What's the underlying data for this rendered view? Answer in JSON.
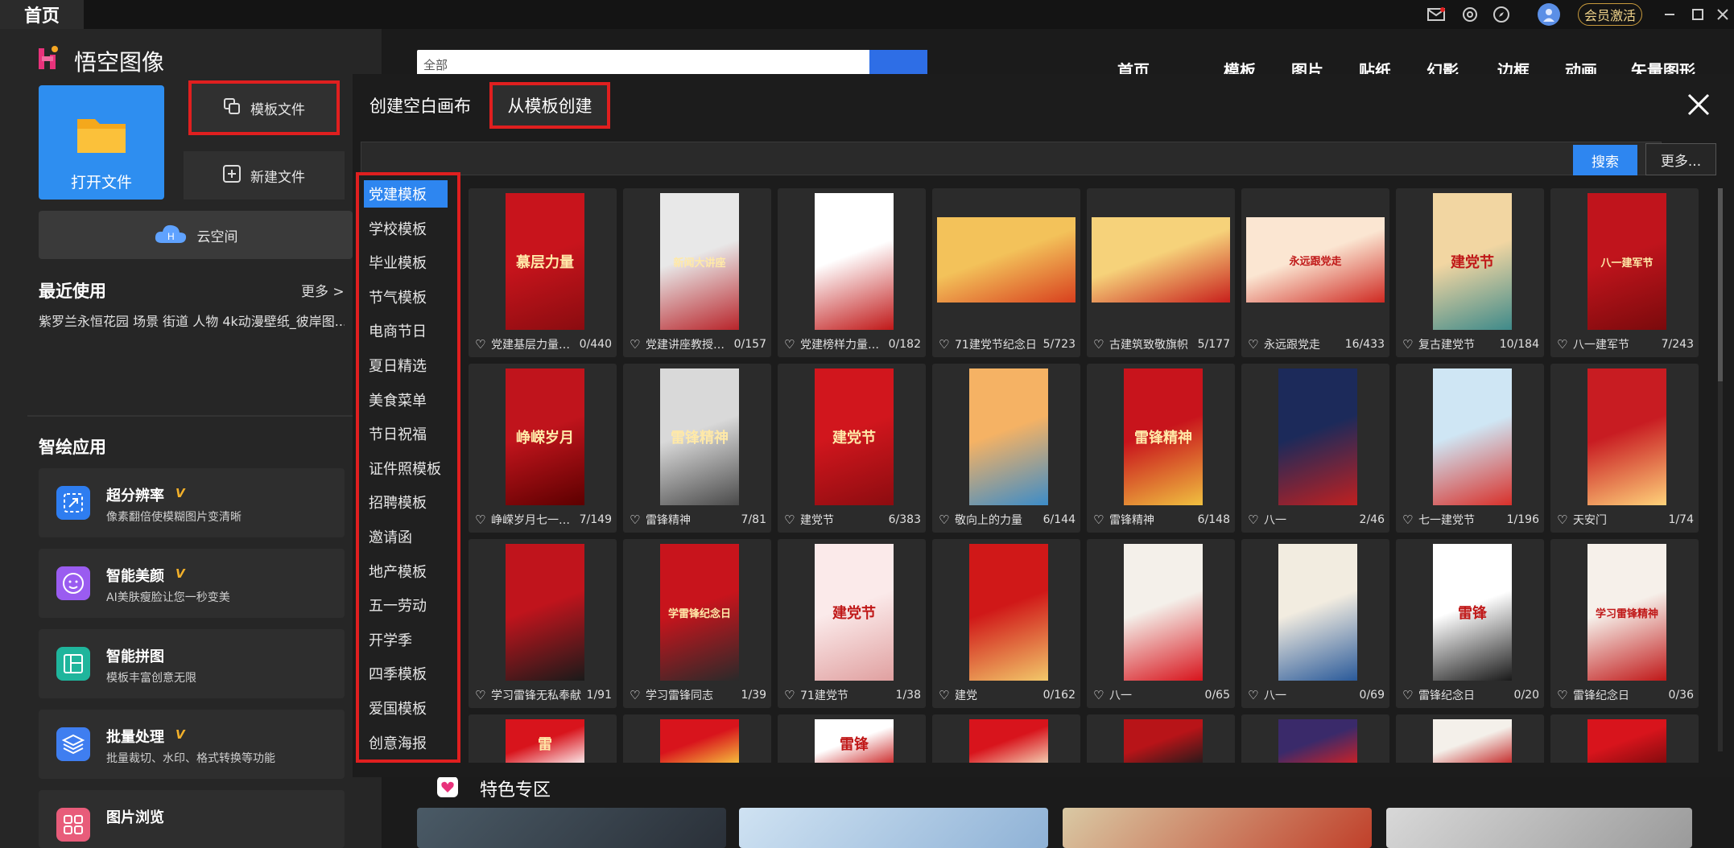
{
  "topbar": {
    "home_tab": "首页",
    "vip_button": "会员激活"
  },
  "sidebar": {
    "app_name": "悟空图像",
    "open_file": "打开文件",
    "template_file": "模板文件",
    "new_file": "新建文件",
    "cloud_space": "云空间",
    "recent_title": "最近使用",
    "recent_more": "更多 >",
    "recent_items": "紫罗兰永恒花园 场景 街道 人物 4k动漫壁纸_彼岸图...",
    "smart_title": "智绘应用",
    "apps": [
      {
        "title": "超分辨率",
        "desc": "像素翻倍使模糊图片变清晰",
        "vip": true
      },
      {
        "title": "智能美颜",
        "desc": "AI美肤瘦脸让您一秒变美",
        "vip": true
      },
      {
        "title": "智能拼图",
        "desc": "模板丰富创意无限",
        "vip": false
      },
      {
        "title": "批量处理",
        "desc": "批量裁切、水印、格式转换等功能",
        "vip": true
      },
      {
        "title": "图片浏览",
        "desc": "",
        "vip": false
      }
    ]
  },
  "main": {
    "search_select": "全部",
    "nav": [
      "首页",
      "模板",
      "图片",
      "贴纸",
      "幻影",
      "边框",
      "动画",
      "矢量图形"
    ],
    "featured_title": "特色专区"
  },
  "dialog": {
    "tab_blank": "创建空白画布",
    "tab_from_template": "从模板创建",
    "search_button": "搜索",
    "more_button": "更多...",
    "categories": [
      "党建模板",
      "学校模板",
      "毕业模板",
      "节气模板",
      "电商节日",
      "夏日精选",
      "美食菜单",
      "节日祝福",
      "证件照模板",
      "招聘模板",
      "邀请函",
      "地产模板",
      "五一劳动",
      "开学季",
      "四季模板",
      "爱国模板",
      "创意海报"
    ],
    "active_category": 0,
    "templates": [
      {
        "name": "党建基层力量劳...",
        "count": "0/440"
      },
      {
        "name": "党建讲座教授新...",
        "count": "0/157"
      },
      {
        "name": "党建榜样力量红...",
        "count": "0/182"
      },
      {
        "name": "71建党节纪念日",
        "count": "5/723"
      },
      {
        "name": "古建筑致敬旗帜",
        "count": "5/177"
      },
      {
        "name": "永远跟党走",
        "count": "16/433"
      },
      {
        "name": "复古建党节",
        "count": "10/184"
      },
      {
        "name": "八一建军节",
        "count": "7/243"
      },
      {
        "name": "峥嵘岁月七一建...",
        "count": "7/149"
      },
      {
        "name": "雷锋精神",
        "count": "7/81"
      },
      {
        "name": "建党节",
        "count": "6/383"
      },
      {
        "name": "敬向上的力量",
        "count": "6/144"
      },
      {
        "name": "雷锋精神",
        "count": "6/148"
      },
      {
        "name": "八一",
        "count": "2/46"
      },
      {
        "name": "七一建党节",
        "count": "1/196"
      },
      {
        "name": "天安门",
        "count": "1/74"
      },
      {
        "name": "学习雷锋无私奉献",
        "count": "1/91"
      },
      {
        "name": "学习雷锋同志",
        "count": "1/39"
      },
      {
        "name": "71建党节",
        "count": "1/38"
      },
      {
        "name": "建党",
        "count": "0/162"
      },
      {
        "name": "八一",
        "count": "0/65"
      },
      {
        "name": "八一",
        "count": "0/69"
      },
      {
        "name": "雷锋纪念日",
        "count": "0/20"
      },
      {
        "name": "雷锋纪念日",
        "count": "0/36"
      },
      {
        "name": "",
        "count": ""
      },
      {
        "name": "",
        "count": ""
      },
      {
        "name": "",
        "count": ""
      },
      {
        "name": "",
        "count": ""
      },
      {
        "name": "",
        "count": ""
      },
      {
        "name": "",
        "count": ""
      },
      {
        "name": "",
        "count": ""
      },
      {
        "name": "",
        "count": ""
      }
    ],
    "thumb_text": [
      "慕层力量",
      "新闻大讲座",
      "",
      "",
      "",
      "永远跟党走",
      "建党节",
      "八一建军节",
      "峥嵘岁月",
      "雷锋精神",
      "建党节",
      "",
      "雷锋精神",
      "",
      "",
      "",
      "",
      "学雷锋纪念日",
      "建党节",
      "",
      "",
      "",
      "雷锋",
      "学习雷锋精神",
      "雷",
      "",
      "雷锋",
      "",
      "",
      "",
      "",
      ""
    ]
  },
  "colors": {
    "accent": "#2e86f0",
    "highlight": "#e01f1f",
    "vip": "#f2b02a"
  }
}
